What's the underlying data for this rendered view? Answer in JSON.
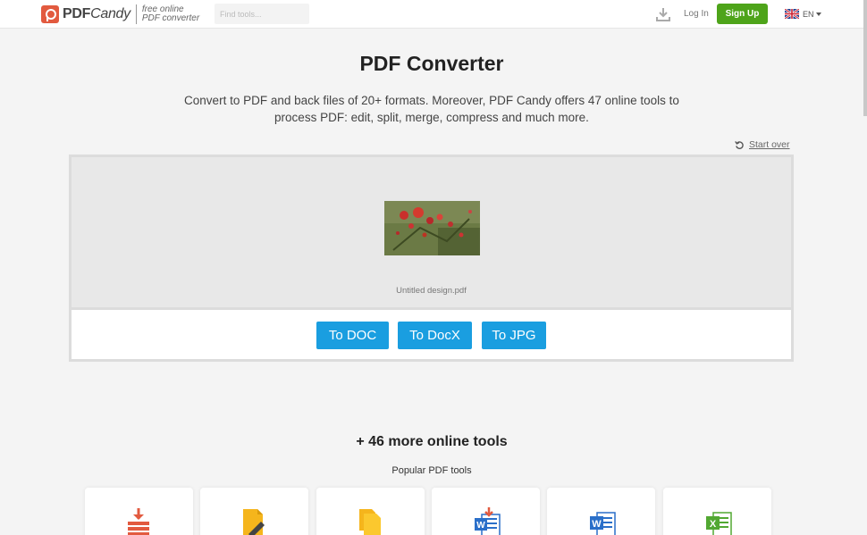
{
  "header": {
    "logo_brand": "PDF",
    "logo_brand_italic": "Candy",
    "tagline_line1": "free online",
    "tagline_line2": "PDF converter",
    "search_placeholder": "Find tools...",
    "login_label": "Log In",
    "signup_label": "Sign Up",
    "language": "EN"
  },
  "main": {
    "title": "PDF Converter",
    "subtitle": "Convert to PDF and back files of 20+ formats. Moreover, PDF Candy offers 47 online tools to process PDF: edit, split, merge, compress and much more.",
    "start_over_label": "Start over",
    "file_name": "Untitled design.pdf",
    "buttons": [
      {
        "label": "To DOC"
      },
      {
        "label": "To DocX"
      },
      {
        "label": "To JPG"
      }
    ],
    "more_tools_heading": "+ 46 more online tools",
    "popular_heading": "Popular PDF tools"
  },
  "tools": [
    {
      "icon": "compress-pdf-icon"
    },
    {
      "icon": "edit-pdf-icon"
    },
    {
      "icon": "copy-pdf-icon"
    },
    {
      "icon": "word-to-pdf-icon"
    },
    {
      "icon": "pdf-to-word-icon"
    },
    {
      "icon": "pdf-to-excel-icon"
    }
  ],
  "colors": {
    "accent_blue": "#1a9ee0",
    "signup_green": "#4ea41a",
    "brand_red": "#e25a3f"
  }
}
